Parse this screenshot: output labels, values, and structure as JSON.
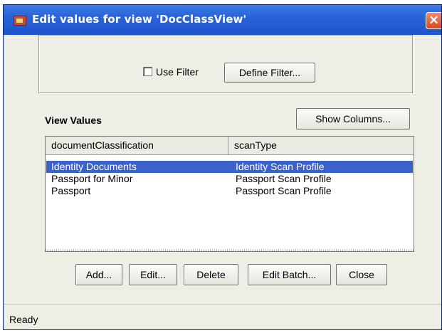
{
  "window": {
    "title": "Edit values for view 'DocClassView'",
    "title_bar_color": "#2a62d8",
    "close_label": "✕"
  },
  "filter": {
    "use_filter_label": "Use Filter",
    "use_filter_checked": false,
    "define_filter_label": "Define Filter..."
  },
  "view_values": {
    "label": "View Values",
    "show_columns_label": "Show Columns...",
    "columns": [
      "documentClassification",
      "scanType"
    ],
    "rows": [
      {
        "documentClassification": "Identity Documents",
        "scanType": "Identity Scan Profile",
        "selected": true
      },
      {
        "documentClassification": "Passport for Minor",
        "scanType": "Passport Scan Profile",
        "selected": false
      },
      {
        "documentClassification": "Passport",
        "scanType": "Passport Scan Profile",
        "selected": false
      }
    ],
    "selection_color": "#3a62c8"
  },
  "buttons": {
    "add": "Add...",
    "edit": "Edit...",
    "delete": "Delete",
    "edit_batch": "Edit Batch...",
    "close": "Close"
  },
  "status": {
    "text": "Ready"
  },
  "icons": {
    "app": "app-window-icon",
    "close": "close-icon"
  }
}
